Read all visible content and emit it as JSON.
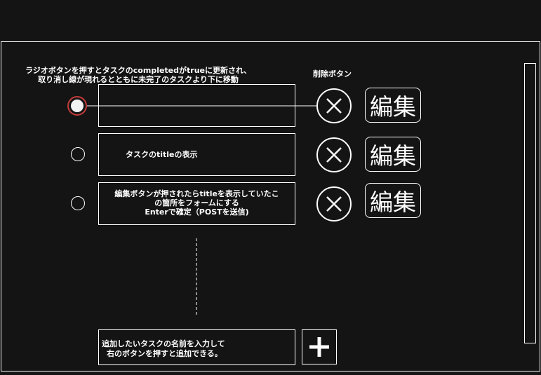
{
  "annotations": {
    "radio_note_line1": "ラジオボタンを押すとタスクのcompletedがtrueに更新され、",
    "radio_note_line2": "取り消し線が現れるとともに未完了のタスクより下に移動",
    "delete_label": "削除ボタン"
  },
  "tasks": {
    "row2_text": "タスクのtitleの表示",
    "row3_line1": "編集ボタンが押されたらtitleを表示していたこ",
    "row3_line2": "の箇所をフォームにする",
    "row3_line3": "Enterで確定（POSTを送信)"
  },
  "buttons": {
    "edit_label": "編集"
  },
  "add_form": {
    "line1": "追加したいタスクの名前を入力して",
    "line2": "右のボタンを押すと追加できる。"
  },
  "icons": {
    "delete": "close-icon",
    "add": "plus-icon"
  },
  "colors": {
    "background": "#141414",
    "selected_radio_ring": "#c23b3b"
  }
}
